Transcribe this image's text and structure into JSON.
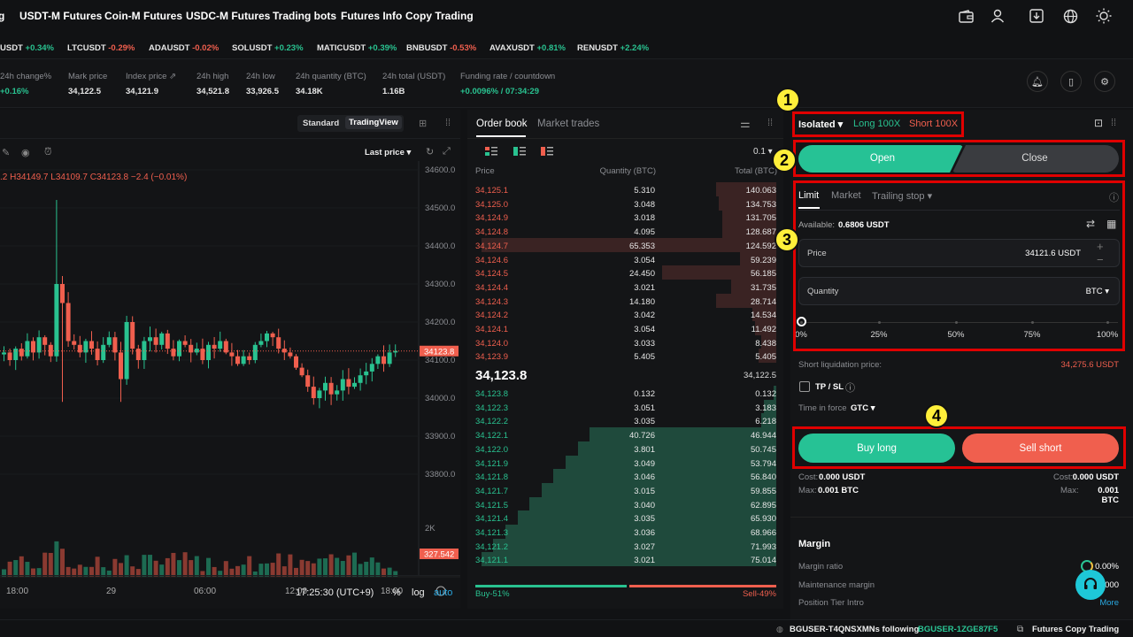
{
  "nav": {
    "items": [
      "g",
      "USDT-M Futures",
      "Coin-M Futures",
      "USDC-M Futures",
      "Trading bots",
      "Futures Info",
      "Copy Trading"
    ]
  },
  "ticker": [
    {
      "sym": "USDT",
      "chg": "+0.34%",
      "dir": "up"
    },
    {
      "sym": "LTCUSDT",
      "chg": "-0.29%",
      "dir": "dn"
    },
    {
      "sym": "ADAUSDT",
      "chg": "-0.02%",
      "dir": "dn"
    },
    {
      "sym": "SOLUSDT",
      "chg": "+0.23%",
      "dir": "up"
    },
    {
      "sym": "MATICUSDT",
      "chg": "+0.39%",
      "dir": "up"
    },
    {
      "sym": "BNBUSDT",
      "chg": "-0.53%",
      "dir": "dn"
    },
    {
      "sym": "AVAXUSDT",
      "chg": "+0.81%",
      "dir": "up"
    },
    {
      "sym": "RENUSDT",
      "chg": "+2.24%",
      "dir": "up"
    }
  ],
  "stats": [
    {
      "label": "24h change%",
      "value": "+0.16%",
      "color": "up"
    },
    {
      "label": "Mark price",
      "value": "34,122.5"
    },
    {
      "label": "Index price ⇗",
      "value": "34,121.9"
    },
    {
      "label": "24h high",
      "value": "34,521.8"
    },
    {
      "label": "24h low",
      "value": "33,926.5"
    },
    {
      "label": "24h quantity (BTC)",
      "value": "34.18K"
    },
    {
      "label": "24h total (USDT)",
      "value": "1.16B"
    },
    {
      "label": "Funding rate / countdown",
      "value": "+0.0096% / 07:34:29",
      "color": "up"
    }
  ],
  "chart": {
    "tabs": [
      "Standard",
      "TradingView"
    ],
    "ohlc": ".2  H34149.7  L34109.7  C34123.8  −2.4 (−0.01%)",
    "last_price_label": "Last price ▾",
    "yticks": [
      "34600.0",
      "34500.0",
      "34400.0",
      "34300.0",
      "34200.0",
      "34100.0",
      "34000.0",
      "33900.0",
      "33800.0"
    ],
    "current_price": "34123.8",
    "vol_tick": "2K",
    "vol_value": "327.542",
    "xticks": [
      "18:00",
      "29",
      "06:00",
      "12:00",
      "18:00"
    ],
    "time": "17:25:30 (UTC+9)",
    "pct": "%",
    "log": "log",
    "auto": "auto"
  },
  "orderbook": {
    "tabs": [
      "Order book",
      "Market trades"
    ],
    "step": "0.1 ▾",
    "cols": [
      "Price",
      "Quantity (BTC)",
      "Total (BTC)"
    ],
    "asks": [
      [
        "34,125.1",
        "5.310",
        "140.063",
        0.2
      ],
      [
        "34,125.0",
        "3.048",
        "134.753",
        0.19
      ],
      [
        "34,124.9",
        "3.018",
        "131.705",
        0.18
      ],
      [
        "34,124.8",
        "4.095",
        "128.687",
        0.18
      ],
      [
        "34,124.7",
        "65.353",
        "124.592",
        0.98
      ],
      [
        "34,124.6",
        "3.054",
        "59.239",
        0.12
      ],
      [
        "34,124.5",
        "24.450",
        "56.185",
        0.38
      ],
      [
        "34,124.4",
        "3.021",
        "31.735",
        0.15
      ],
      [
        "34,124.3",
        "14.180",
        "28.714",
        0.2
      ],
      [
        "34,124.2",
        "3.042",
        "14.534",
        0.08
      ],
      [
        "34,124.1",
        "3.054",
        "11.492",
        0.07
      ],
      [
        "34,124.0",
        "3.033",
        "8.438",
        0.05
      ],
      [
        "34,123.9",
        "5.405",
        "5.405",
        0.06
      ]
    ],
    "mid_price": "34,123.8",
    "mid_mark": "34,122.5",
    "bids": [
      [
        "34,123.8",
        "0.132",
        "0.132",
        0.01
      ],
      [
        "34,122.3",
        "3.051",
        "3.183",
        0.04
      ],
      [
        "34,122.2",
        "3.035",
        "6.218",
        0.05
      ],
      [
        "34,122.1",
        "40.726",
        "46.944",
        0.62
      ],
      [
        "34,122.0",
        "3.801",
        "50.745",
        0.66
      ],
      [
        "34,121.9",
        "3.049",
        "53.794",
        0.7
      ],
      [
        "34,121.8",
        "3.046",
        "56.840",
        0.74
      ],
      [
        "34,121.7",
        "3.015",
        "59.855",
        0.78
      ],
      [
        "34,121.5",
        "3.040",
        "62.895",
        0.82
      ],
      [
        "34,121.4",
        "3.035",
        "65.930",
        0.86
      ],
      [
        "34,121.3",
        "3.036",
        "68.966",
        0.9
      ],
      [
        "34,121.2",
        "3.027",
        "71.993",
        0.94
      ],
      [
        "34,121.1",
        "3.021",
        "75.014",
        0.98
      ]
    ],
    "buy_pct": "Buy-51%",
    "sell_pct": "Sell-49%"
  },
  "trade": {
    "margin_mode": "Isolated ▾",
    "long_lev": "Long 100X",
    "short_lev": "Short 100X",
    "open": "Open",
    "close": "Close",
    "order_tabs": [
      "Limit",
      "Market",
      "Trailing stop ▾"
    ],
    "available_label": "Available:",
    "available": "0.6806 USDT",
    "price_label": "Price",
    "price_value": "34121.6 USDT",
    "qty_label": "Quantity",
    "qty_unit": "BTC ▾",
    "slider": [
      "0%",
      "25%",
      "50%",
      "75%",
      "100%"
    ],
    "liq_label": "Short liquidation price:",
    "liq_value": "34,275.6 USDT",
    "tpsl": "TP / SL",
    "tif_label": "Time in force",
    "tif_value": "GTC ▾",
    "buy": "Buy long",
    "sell": "Sell short",
    "cost_l": "Cost:",
    "cost_lv": "0.000 USDT",
    "cost_r": "Cost:",
    "cost_rv": "0.000 USDT",
    "max_l": "Max:",
    "max_lv": "0.001 BTC",
    "max_r": "Max:",
    "max_rv": "0.001 BTC",
    "margin_title": "Margin",
    "margin_ratio": "Margin ratio",
    "margin_ratio_v": "0.00%",
    "maint": "Maintenance margin",
    "maint_v": "000",
    "tier": "Position Tier Intro",
    "more": "More"
  },
  "annotations": [
    "1",
    "2",
    "3",
    "4"
  ],
  "footer": {
    "user": "BGUSER-T4QNSXMN",
    "following": "is following",
    "target": "BGUSER-1ZGE87F5",
    "copy": "Futures Copy Trading"
  },
  "colors": {
    "up": "#29c290",
    "down": "#f05f4e",
    "accent": "#2ac595",
    "annot": "#e00000"
  }
}
